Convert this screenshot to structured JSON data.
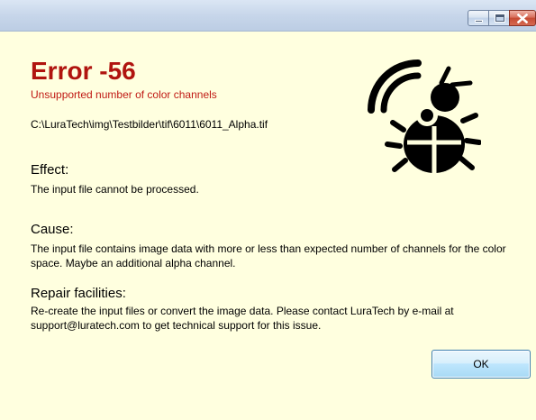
{
  "window": {
    "caption_buttons": {
      "minimize_icon": "minimize-icon",
      "maximize_icon": "maximize-icon",
      "close_icon": "close-icon"
    }
  },
  "error": {
    "title": "Error -56",
    "subtitle": "Unsupported number of color channels",
    "file_path": "C:\\LuraTech\\img\\Testbilder\\tif\\6011\\6011_Alpha.tif",
    "icon": "bug-icon"
  },
  "sections": {
    "effect": {
      "heading": "Effect:",
      "text": "The input file cannot be processed."
    },
    "cause": {
      "heading": "Cause:",
      "text": "The input file contains image data with more or less than expected number of channels for the color space. Maybe an additional alpha channel."
    },
    "repair": {
      "heading": "Repair facilities:",
      "text": "Re-create the input files or convert the image data. Please contact LuraTech by e-mail at support@luratech.com to get technical support for this issue."
    }
  },
  "buttons": {
    "ok_label": "OK"
  },
  "colors": {
    "background": "#ffffdf",
    "error_title": "#b0140f",
    "error_subtitle": "#c01a14"
  }
}
